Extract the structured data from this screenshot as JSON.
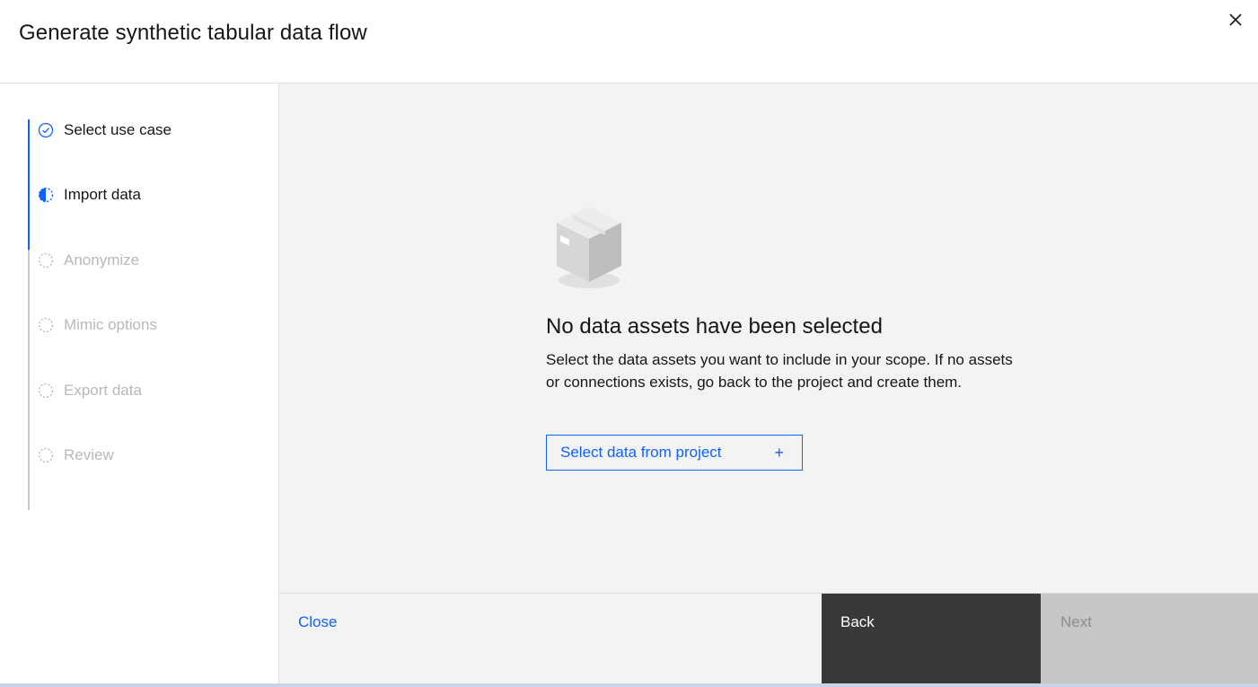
{
  "header": {
    "title": "Generate synthetic tabular data flow",
    "close_icon": "close-icon"
  },
  "sidebar": {
    "steps": [
      {
        "label": "Select use case",
        "state": "complete",
        "icon": "checkmark-circle-icon"
      },
      {
        "label": "Import data",
        "state": "current",
        "icon": "half-circle-icon"
      },
      {
        "label": "Anonymize",
        "state": "incomplete",
        "icon": "dashed-circle-icon"
      },
      {
        "label": "Mimic options",
        "state": "incomplete",
        "icon": "dashed-circle-icon"
      },
      {
        "label": "Export data",
        "state": "incomplete",
        "icon": "dashed-circle-icon"
      },
      {
        "label": "Review",
        "state": "incomplete",
        "icon": "dashed-circle-icon"
      }
    ]
  },
  "main": {
    "illustration_icon": "empty-box-icon",
    "empty_title": "No data assets have been selected",
    "empty_description": "Select the data assets you want to include in your scope. If no assets or connections exists, go back to the project and create them.",
    "select_button_label": "Select data from project",
    "select_button_icon": "+"
  },
  "footer": {
    "close_label": "Close",
    "back_label": "Back",
    "next_label": "Next"
  },
  "colors": {
    "accent": "#0f62fe",
    "back_button": "#393939",
    "disabled_button": "#c6c6c6",
    "panel_bg": "#f3f3f3"
  }
}
